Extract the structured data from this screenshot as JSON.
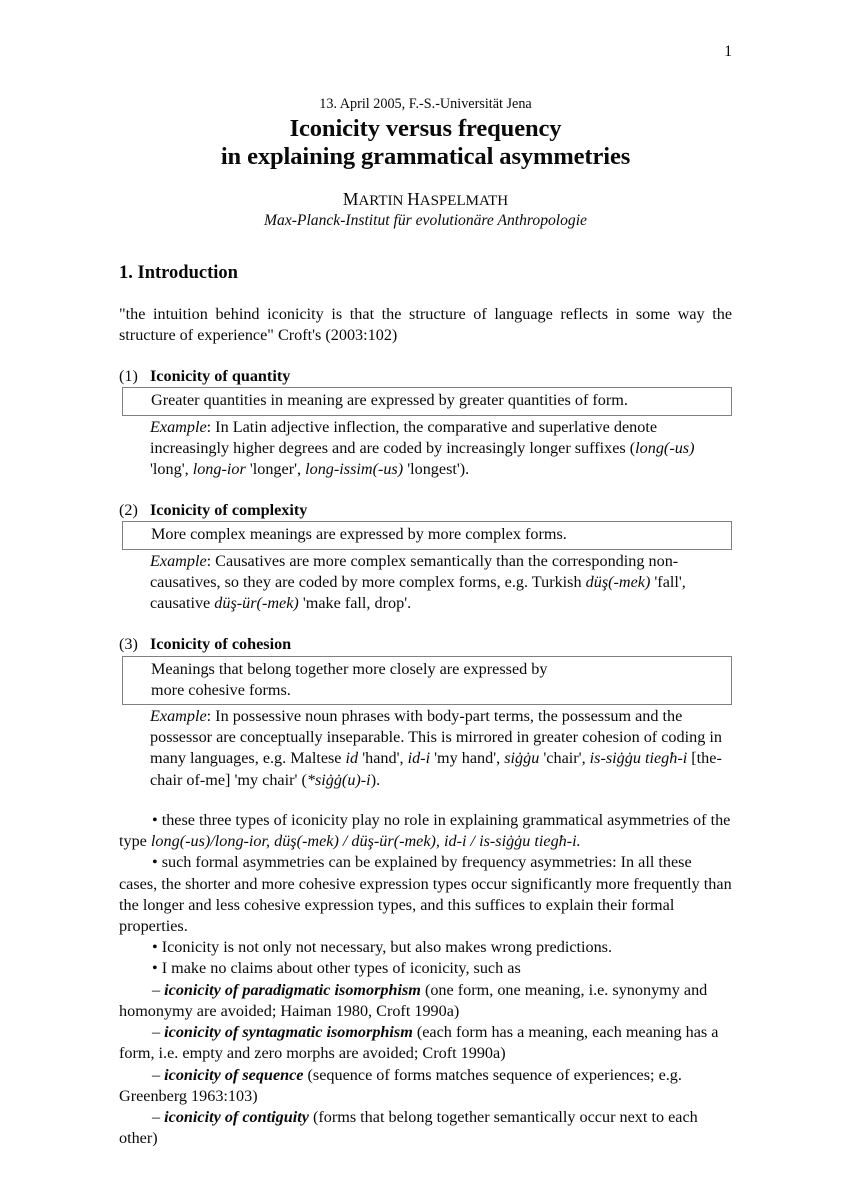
{
  "page": {
    "number": "1"
  },
  "header": {
    "venue": "13. April 2005, F.-S.-Universität Jena",
    "title_line1": "Iconicity versus frequency",
    "title_line2": "in explaining grammatical asymmetries",
    "author": "MARTIN HASPELMATH",
    "affiliation": "Max-Planck-Institut für evolutionäre Anthropologie"
  },
  "section": {
    "heading": "1. Introduction",
    "quote": "\"the intuition behind iconicity is that the structure of language reflects in some way the structure of experience\" Croft's (2003:102)"
  },
  "examples": [
    {
      "number": "(1)",
      "title": "Iconicity of quantity",
      "definition_lines": [
        "Greater quantities in meaning are expressed by greater quantities of form."
      ],
      "example_label": "Example",
      "example_text_html": ": In Latin adjective inflection, the comparative and superlative denote increasingly higher degrees and are coded by increasingly longer suffixes (<i>long(-us)</i> 'long', <i>long-ior</i> 'longer', <i>long-issim(-us)</i> 'longest')."
    },
    {
      "number": "(2)",
      "title": "Iconicity of complexity",
      "definition_lines": [
        "More complex meanings are expressed by more complex forms."
      ],
      "example_label": "Example",
      "example_text_html": ": Causatives are more complex semantically than the corresponding non-causatives, so they are coded by more complex forms, e.g. Turkish <i>düş(-mek)</i> 'fall', causative <i>düş-ür(-mek)</i> 'make fall, drop'."
    },
    {
      "number": "(3)",
      "title": "Iconicity of cohesion",
      "definition_lines": [
        "Meanings that belong together more closely are expressed by",
        "more cohesive forms."
      ],
      "example_label": "Example",
      "example_text_html": ": In possessive noun phrases with body-part terms, the possessum and the possessor are conceptually inseparable. This is mirrored in greater cohesion of coding in many languages, e.g. Maltese <i>id</i> 'hand', <i>id-i</i> 'my hand', <i>siġġu</i> 'chair', <i>is-siġġu tiegħ-i</i> [the-chair of-me] 'my chair' (<i>*siġġ(u)-i</i>)."
    }
  ],
  "notes": [
    {
      "marker": "•",
      "text_html": " these three types of iconicity play no role in explaining grammatical asymmetries of the type <i>long(-us)/long-ior, düş(-mek) / düş-ür(-mek), id-i / is-siġġu tiegħ-i.</i>"
    },
    {
      "marker": "•",
      "text_html": " such formal asymmetries can be explained by frequency asymmetries: In all these cases, the shorter and more cohesive expression types occur significantly more frequently than the longer and less cohesive expression types, and this suffices to explain their formal properties."
    },
    {
      "marker": "•",
      "text_html": " Iconicity is not only not necessary, but also makes wrong predictions."
    },
    {
      "marker": "•",
      "text_html": " I make no claims about other types of iconicity, such as"
    },
    {
      "marker": "–",
      "text_html": " <span class=\"term\">iconicity of paradigmatic isomorphism</span> (one form, one meaning, i.e. synonymy and homonymy are avoided; Haiman 1980, Croft 1990a)"
    },
    {
      "marker": "–",
      "text_html": " <span class=\"term\">iconicity of syntagmatic isomorphism</span> (each form has a meaning, each meaning has a form, i.e. empty and zero morphs are avoided; Croft 1990a)"
    },
    {
      "marker": "–",
      "text_html": " <span class=\"term\">iconicity of sequence</span> (sequence of forms matches sequence of experiences; e.g. Greenberg 1963:103)"
    },
    {
      "marker": "–",
      "text_html": " <span class=\"term\">iconicity of contiguity</span> (forms that belong together semantically occur next to each other)"
    }
  ]
}
